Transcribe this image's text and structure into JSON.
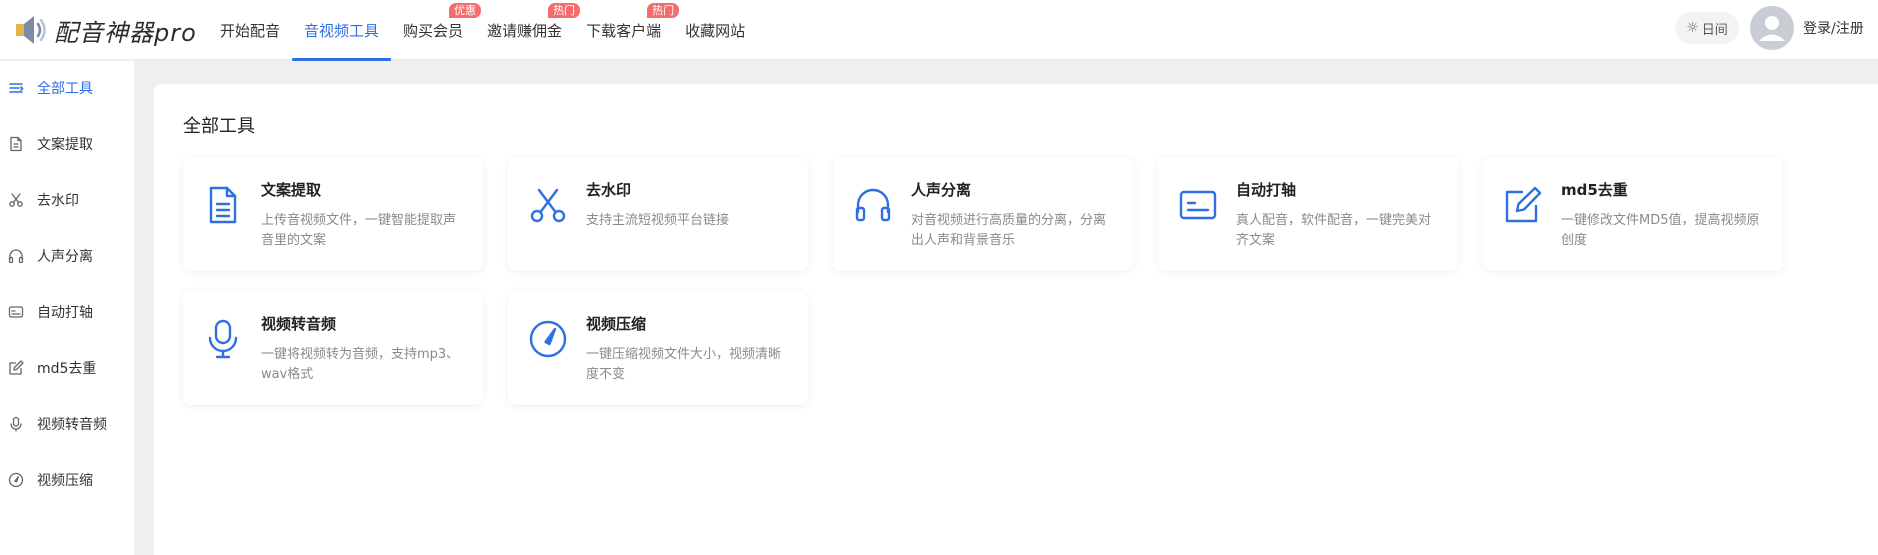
{
  "header": {
    "logo_text": "配音神器pro",
    "nav": [
      {
        "label": "开始配音",
        "badge": ""
      },
      {
        "label": "音视频工具",
        "badge": ""
      },
      {
        "label": "购买会员",
        "badge": "优惠"
      },
      {
        "label": "邀请赚佣金",
        "badge": "热门"
      },
      {
        "label": "下载客户端",
        "badge": "热门"
      },
      {
        "label": "收藏网站",
        "badge": ""
      }
    ],
    "theme_label": "日间",
    "login_label": "登录/注册"
  },
  "sidebar": {
    "items": [
      {
        "label": "全部工具",
        "icon": "list-icon"
      },
      {
        "label": "文案提取",
        "icon": "document-icon"
      },
      {
        "label": "去水印",
        "icon": "scissors-icon"
      },
      {
        "label": "人声分离",
        "icon": "headphones-icon"
      },
      {
        "label": "自动打轴",
        "icon": "subtitle-icon"
      },
      {
        "label": "md5去重",
        "icon": "edit-icon"
      },
      {
        "label": "视频转音频",
        "icon": "microphone-icon"
      },
      {
        "label": "视频压缩",
        "icon": "compass-icon"
      }
    ]
  },
  "main": {
    "title": "全部工具",
    "tools": [
      {
        "title": "文案提取",
        "desc": "上传音视频文件，一键智能提取声音里的文案",
        "icon": "document-icon"
      },
      {
        "title": "去水印",
        "desc": "支持主流短视频平台链接",
        "icon": "scissors-icon"
      },
      {
        "title": "人声分离",
        "desc": "对音视频进行高质量的分离，分离出人声和背景音乐",
        "icon": "headphones-icon"
      },
      {
        "title": "自动打轴",
        "desc": "真人配音，软件配音，一键完美对齐文案",
        "icon": "subtitle-icon"
      },
      {
        "title": "md5去重",
        "desc": "一键修改文件MD5值，提高视频原创度",
        "icon": "edit-icon"
      },
      {
        "title": "视频转音频",
        "desc": "一键将视频转为音频，支持mp3、wav格式",
        "icon": "microphone-icon"
      },
      {
        "title": "视频压缩",
        "desc": "一键压缩视频文件大小，视频清晰度不变",
        "icon": "compass-icon"
      }
    ]
  },
  "colors": {
    "accent": "#2f6fe4",
    "badge": "#f56c6c"
  }
}
